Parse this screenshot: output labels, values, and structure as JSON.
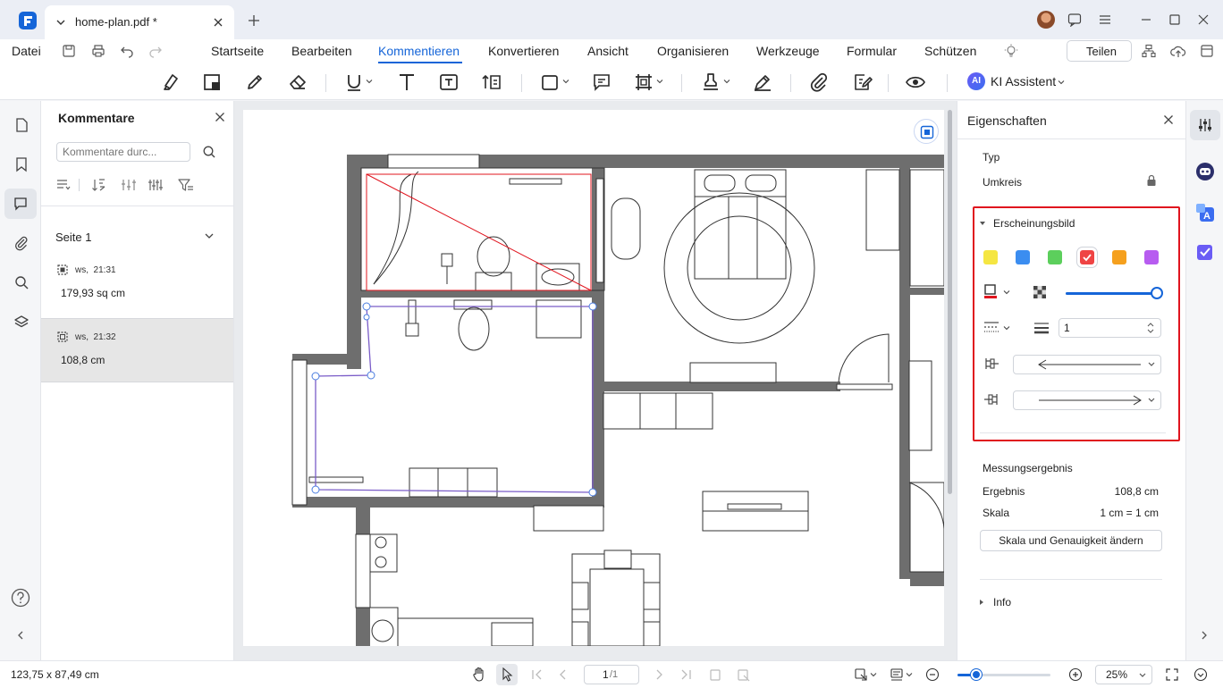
{
  "app": {
    "tab_title": "home-plan.pdf *",
    "share_label": "Teilen"
  },
  "menu": [
    "Datei",
    "Startseite",
    "Bearbeiten",
    "Kommentieren",
    "Konvertieren",
    "Ansicht",
    "Organisieren",
    "Werkzeuge",
    "Formular",
    "Schützen"
  ],
  "toolbar": {
    "ai_badge": "AI",
    "ai_label": "KI Assistent"
  },
  "comments": {
    "title": "Kommentare",
    "search_placeholder": "Kommentare durc...",
    "section": "Seite 1",
    "items": [
      {
        "meta": "ws,  21:31",
        "value": "179,93 sq cm"
      },
      {
        "meta": "ws,  21:32",
        "value": "108,8 cm"
      }
    ]
  },
  "props": {
    "title": "Eigenschaften",
    "type_label": "Typ",
    "type_value": "Umkreis",
    "appearance": "Erscheinungsbild",
    "colors": [
      "#f5e642",
      "#3b8df0",
      "#5ccf5c",
      "#ef4444",
      "#f5a01e",
      "#b75cf0"
    ],
    "selected_color": "#ef4444",
    "opacity": 1.0,
    "line_width": "1",
    "measure_title": "Messungsergebnis",
    "result_label": "Ergebnis",
    "result_value": "108,8 cm",
    "scale_label": "Skala",
    "scale_value": "1 cm = 1 cm",
    "scale_button": "Skala und Genauigkeit ändern",
    "info_label": "Info",
    "accent": "#e0141e"
  },
  "status": {
    "coords": "123,75 x 87,49 cm",
    "page": "1",
    "total": "/1",
    "zoom": "25%",
    "zoom_level": 0.2
  }
}
